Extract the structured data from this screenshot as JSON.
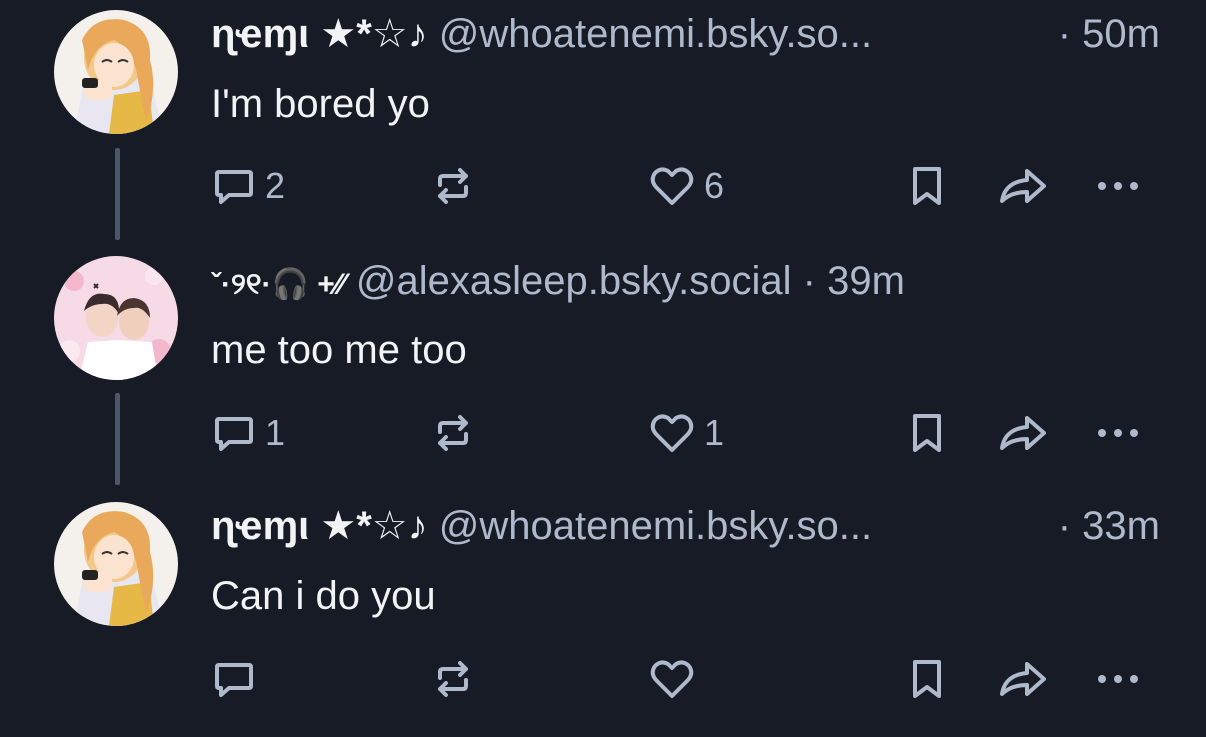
{
  "posts": [
    {
      "display_name": "ɳҽɱι ★*☆♪",
      "handle": "@whoatenemi.bsky.so...",
      "time": "· 50m",
      "text": "I'm bored yo",
      "reply_count": "2",
      "repost_count": "",
      "like_count": "6",
      "avatar_icon": "anime-girl-avatar"
    },
    {
      "display_name": "ˇ·୨୧·🎧 +⁄⁄",
      "handle": "@alexasleep.bsky.social",
      "time": "· 39m",
      "text": "me too me too",
      "reply_count": "1",
      "repost_count": "",
      "like_count": "1",
      "avatar_icon": "pink-collage-avatar"
    },
    {
      "display_name": "ɳҽɱι ★*☆♪",
      "handle": "@whoatenemi.bsky.so...",
      "time": "· 33m",
      "text": "Can i do you",
      "reply_count": "",
      "repost_count": "",
      "like_count": "",
      "avatar_icon": "anime-girl-avatar"
    }
  ],
  "colors": {
    "background": "#161b26",
    "text": "#f1f3f5",
    "muted": "#aeb9cb",
    "thread_line": "#4b5668"
  },
  "icons": [
    "reply-icon",
    "repost-icon",
    "like-icon",
    "bookmark-icon",
    "share-icon",
    "more-icon"
  ]
}
